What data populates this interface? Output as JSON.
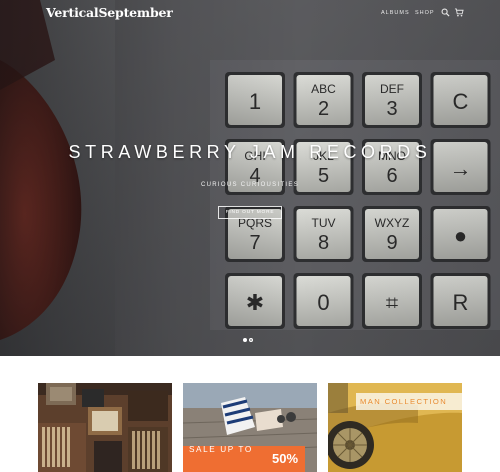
{
  "brand": {
    "logo": "VerticalSeptember"
  },
  "nav": {
    "links": [
      "ALBUMS",
      "SHOP"
    ],
    "search_icon": "search-icon",
    "cart_icon": "cart-icon"
  },
  "hero": {
    "title": "STRAWBERRY JAM RECORDS",
    "subtitle": "CURIOUS CURIOUSITIES",
    "button": "FIND OUT MORE",
    "slides": {
      "total": 2,
      "active": 1
    },
    "keypad": [
      {
        "digit": "1",
        "letters": ""
      },
      {
        "digit": "2",
        "letters": "ABC"
      },
      {
        "digit": "3",
        "letters": "DEF"
      },
      {
        "digit": "C",
        "letters": ""
      },
      {
        "digit": "4",
        "letters": "GHI"
      },
      {
        "digit": "5",
        "letters": "JKL"
      },
      {
        "digit": "6",
        "letters": "MNO"
      },
      {
        "digit": "→",
        "letters": ""
      },
      {
        "digit": "7",
        "letters": "PQRS"
      },
      {
        "digit": "8",
        "letters": "TUV"
      },
      {
        "digit": "9",
        "letters": "WXYZ"
      },
      {
        "digit": "●",
        "letters": ""
      },
      {
        "digit": "✱",
        "letters": ""
      },
      {
        "digit": "0",
        "letters": ""
      },
      {
        "digit": "⌗",
        "letters": ""
      },
      {
        "digit": "R",
        "letters": ""
      }
    ]
  },
  "tiles": {
    "sale": {
      "text": "SALE UP TO",
      "value": "50%"
    },
    "man": {
      "text": "MAN COLLECTION"
    }
  },
  "colors": {
    "accent_orange": "#ef6e32",
    "man_text": "#e88b33",
    "hero_dark": "#4a4b4e"
  }
}
